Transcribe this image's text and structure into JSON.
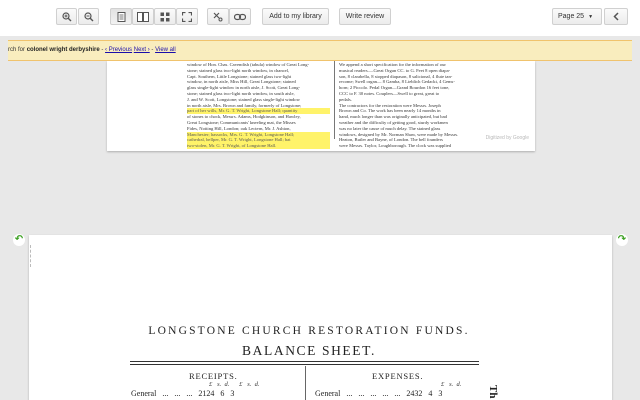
{
  "toolbar": {
    "zoom_in_icon": "zoom-in-icon",
    "zoom_out_icon": "zoom-out-icon",
    "view_modes": [
      "one-page",
      "two-page",
      "thumbnails",
      "fullscreen"
    ],
    "clip_icon": "clip-icon",
    "link_icon": "link-icon",
    "add_to_library": "Add to my library",
    "write_review": "Write review",
    "page_select": "Page 25",
    "back_icon": "chevron-left-icon"
  },
  "search": {
    "prefix": "rch for",
    "query": "colonel wright derbyshire",
    "sep": " - ",
    "prev": "‹ Previous",
    "next": "Next ›",
    "dash": " - ",
    "view_all": "View all"
  },
  "page1": {
    "col1": [
      "window of Hon. Chas. Cavendish (tabula) window of Great Long-",
      "stone; stained glass two-light north window, in chancel,",
      "Capt. Southern, Little Longstone; stained glass two-light",
      "window, in north aisle, Miss Hill, Great Longstone; stained",
      "glass single-light window in north aisle, J. Scott, Great Long-",
      "stone; stained glass two-light north window, in south aisle,",
      "J. and W. Scott, Longstone; stained glass single-light window",
      "in north aisle, Mrs. Brown and family, formerly of Longstone;",
      "part of her wills, Mr. G. T. Wright, Longstone Hall; quantity",
      "of stones to chock, Messrs. Adams, Hodgkinson, and Hawley,",
      "Great Longstone; Communicants' kneeling mat, the Misses",
      "Fides, Notting Hill, London; oak Lectern, Mr. J. Ashton,",
      "Manchester; hassocks, Mrs. G. T. Wright, Longstone Hall;",
      "cathedral, bellper, Mr. G. T. Wright, Longstone Hall; bat",
      "two-stolen, Mr. G. T. Wright, of Longstone Hall."
    ],
    "col2": [
      "We append a short specification for the information of our",
      "musical readers.—Great Organ CC. to G. Feet 8 open diapa-",
      "son, 8 clarabella, 8 stopped diapason, 8 salicional, 4 flute tan-",
      "recome; Swell organ— 8 Gamba, 8 Lieblich Gedackt, 4 Gems-",
      "horn; 2 Piccolo. Pedal Organ—Grand Bourdon 16 feet tone,",
      "CCC to F. 30 notes. Couplers—Swell to great, great to",
      "pedals.",
      "The contractors for the restoration were Messrs. Joseph",
      "Brown and Co. The work has been nearly 14 months in",
      "hand, much longer than was originally anticipated, but bad",
      "weather and the difficulty of getting good, sturdy workmen",
      "was no later the cause of much delay. The stained glass",
      "windows, designed by Mr. Norman Shaw, were made by Messrs.",
      "Heaton, Butler and Bayne, of London. The bell founders",
      "were Messrs. Taylor, Loughborough. The clock was supplied"
    ],
    "digitized": "Digitized by Google"
  },
  "page2": {
    "title": "LONGSTONE CHURCH RESTORATION FUNDS.",
    "subtitle": "BALANCE SHEET.",
    "receipts": "RECEIPTS.",
    "expenses": "EXPENSES.",
    "units_left": "£   s.  d.      £   s.  d.",
    "units_right": "£   s.  d.",
    "row_left": "General   ...   ...   ...   2124   6   3",
    "row_right": "General   ...   ...   ...   ...   ...   2432   4   3",
    "side": "Th"
  },
  "colors": {
    "search_bar_bg": "#f9edbe",
    "search_bar_border": "#f0c36d",
    "highlight": "#fff36a",
    "rotate_icon": "#3a9f20",
    "link": "#1a0dab"
  }
}
